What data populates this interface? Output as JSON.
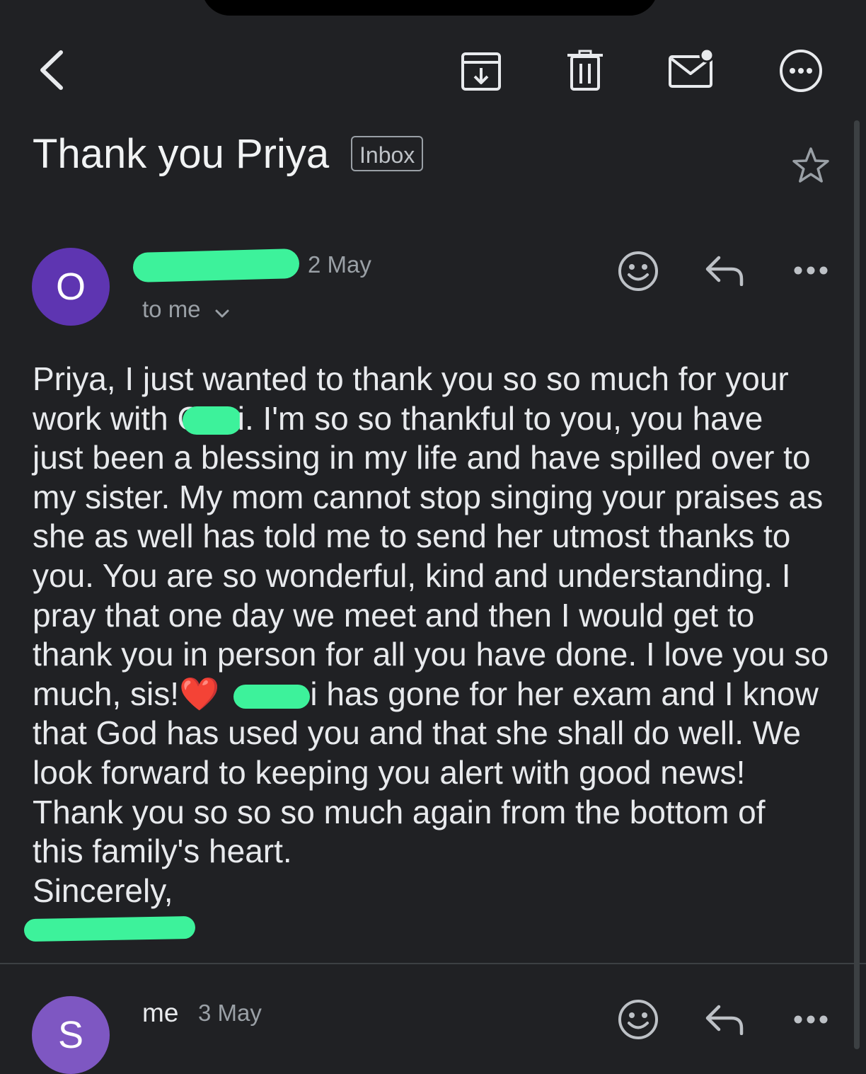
{
  "toolbar": {
    "icons": [
      "back-arrow-icon",
      "archive-icon",
      "trash-icon",
      "mark-unread-icon",
      "more-options-icon"
    ]
  },
  "email": {
    "subject": "Thank you Priya",
    "label": "Inbox",
    "star_icon": "star-outline-icon"
  },
  "messages": [
    {
      "avatar_letter": "O",
      "avatar_color": "#5e35b1",
      "sender": "",
      "date": "2 May",
      "recipient": "to me",
      "actions": [
        "emoji-react-icon",
        "reply-icon",
        "more-icon"
      ],
      "body_lines": [
        "Priya, I just wanted to thank you so so much for your",
        "work with C",
        "i. I'm so so thankful to you, you have",
        "just been a blessing in my life and have spilled over to",
        "my sister. My mom cannot stop singing your praises as",
        "she as well has told me to send her utmost thanks to",
        "you. You are so wonderful, kind and understanding. I",
        "pray that one day we meet and then I would get to",
        "thank you in person for all you have done. I love you so",
        "much, sis!",
        "❤️",
        "i has gone for her exam and I know",
        "that God has used you and that she shall do well. We",
        "look forward to keeping you alert with good news!",
        "Thank you so so so much again from the bottom of",
        "this family's heart.",
        "Sincerely,"
      ]
    },
    {
      "avatar_letter": "S",
      "avatar_color": "#7e57c2",
      "sender": "me",
      "date": "3 May",
      "actions": [
        "emoji-react-icon",
        "reply-icon",
        "more-icon"
      ]
    }
  ],
  "colors": {
    "background": "#202124",
    "redaction": "#3df29b",
    "text": "#e8eaed",
    "muted": "#9aa0a6"
  }
}
